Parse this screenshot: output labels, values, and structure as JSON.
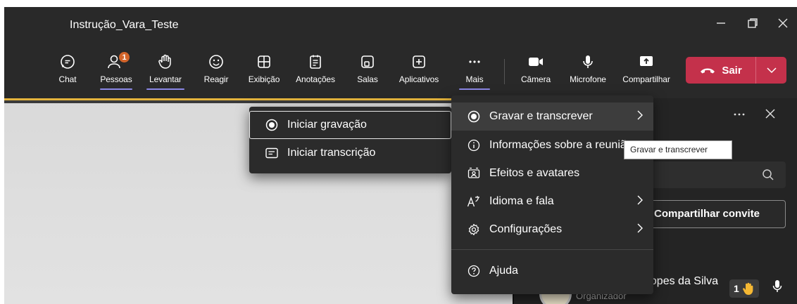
{
  "window": {
    "title": "Instrução_Vara_Teste"
  },
  "toolbar": {
    "chat": "Chat",
    "people": "Pessoas",
    "people_badge": "1",
    "raise": "Levantar",
    "react": "Reagir",
    "view": "Exibição",
    "notes": "Anotações",
    "rooms": "Salas",
    "apps": "Aplicativos",
    "more": "Mais",
    "camera": "Câmera",
    "mic": "Microfone",
    "share": "Compartilhar",
    "leave": "Sair"
  },
  "more_menu": {
    "items": [
      {
        "label": "Gravar e transcrever",
        "icon": "record-icon",
        "has_submenu": true
      },
      {
        "label": "Informações sobre a reunião",
        "icon": "info-icon",
        "has_submenu": false
      },
      {
        "label": "Efeitos e avatares",
        "icon": "effects-icon",
        "has_submenu": false
      },
      {
        "label": "Idioma e fala",
        "icon": "language-icon",
        "has_submenu": true
      },
      {
        "label": "Configurações",
        "icon": "gear-icon",
        "has_submenu": true
      },
      {
        "label": "Ajuda",
        "icon": "help-icon",
        "has_submenu": false
      }
    ]
  },
  "record_submenu": {
    "items": [
      {
        "label": "Iniciar gravação",
        "icon": "record-icon"
      },
      {
        "label": "Iniciar transcrição",
        "icon": "transcript-icon"
      }
    ]
  },
  "tooltip": "Gravar e transcrever",
  "panel": {
    "invite": "Compartilhar convite",
    "participant_name": "Lopes da Silva",
    "participant_role": "Organizador",
    "hand_count": "1"
  },
  "colors": {
    "leave": "#c4314b",
    "badge": "#d2642a",
    "accent": "#8b87e6",
    "spotlight_border": "#e4b43c"
  }
}
